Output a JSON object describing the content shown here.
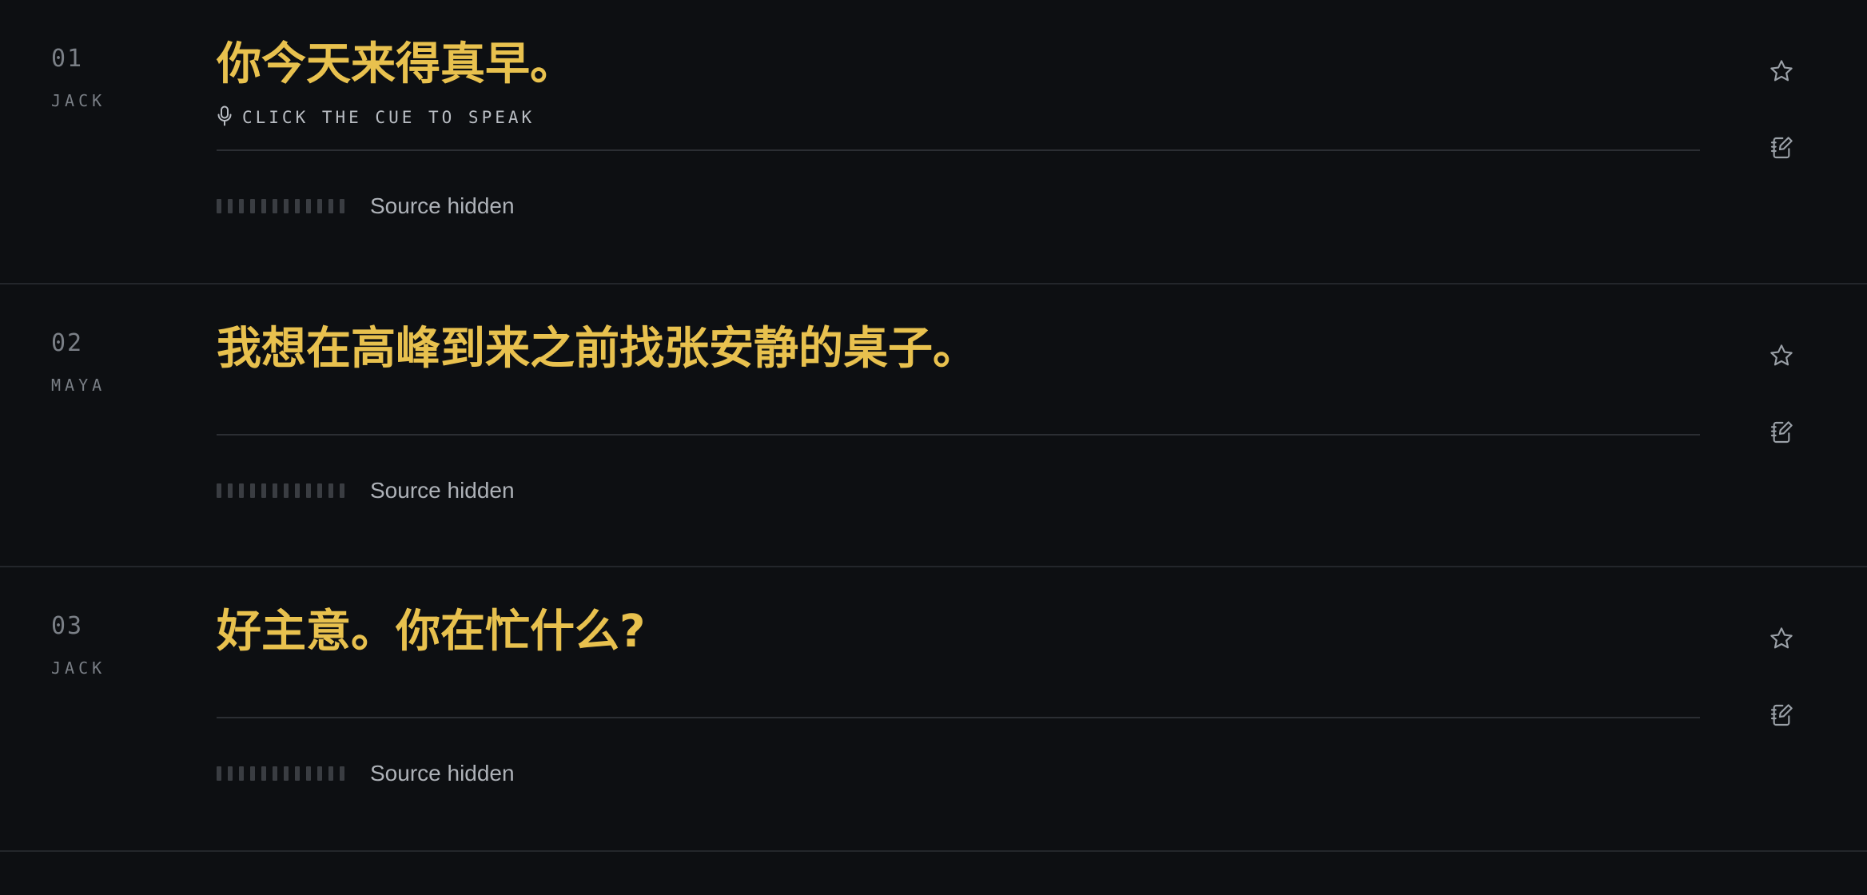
{
  "lines": [
    {
      "number": "01",
      "speaker": "JACK",
      "text": "你今天来得真早。",
      "cue": "CLICK THE CUE TO SPEAK",
      "source": "Source hidden"
    },
    {
      "number": "02",
      "speaker": "MAYA",
      "text": "我想在高峰到来之前找张安静的桌子。",
      "cue": "",
      "source": "Source hidden"
    },
    {
      "number": "03",
      "speaker": "JACK",
      "text": "好主意。你在忙什么?",
      "cue": "",
      "source": "Source hidden"
    }
  ],
  "icons": {
    "mic": "microphone-icon",
    "star": "star-icon",
    "note": "notebook-edit-icon"
  },
  "colors": {
    "background": "#0d0f12",
    "accent": "#e8c14e",
    "muted": "#7a7f86",
    "divider": "#2b2e33"
  }
}
